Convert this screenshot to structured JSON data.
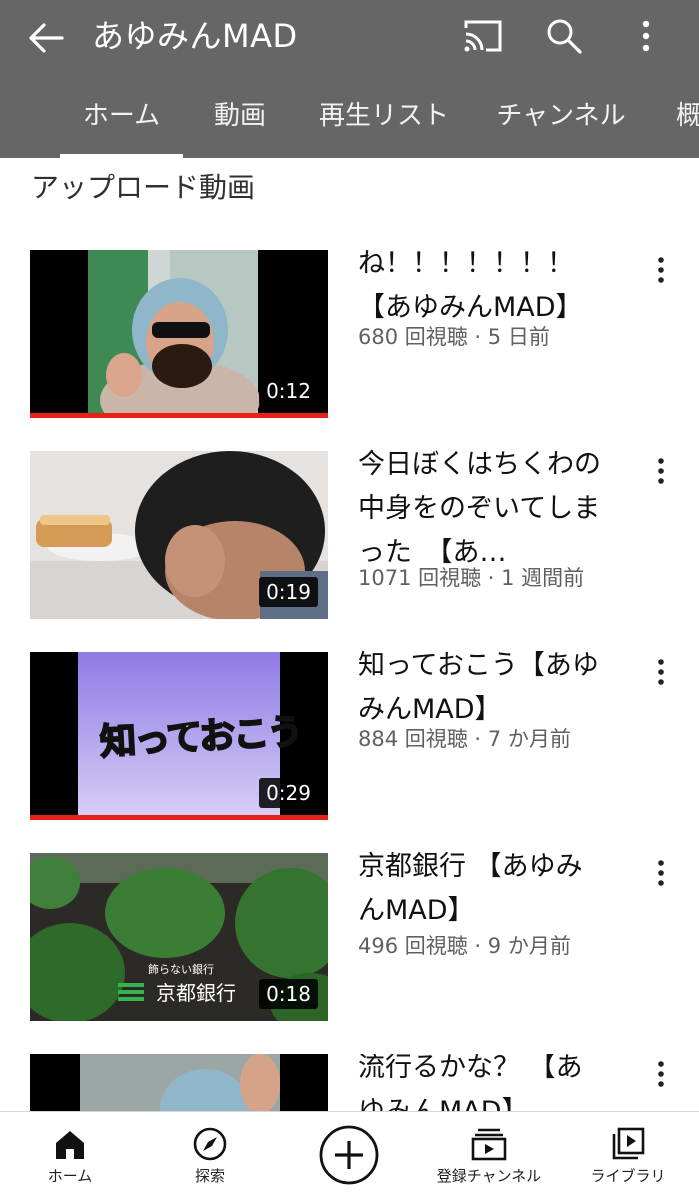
{
  "header": {
    "title": "あゆみんMAD",
    "tabs": [
      {
        "label": "ホーム"
      },
      {
        "label": "動画"
      },
      {
        "label": "再生リスト"
      },
      {
        "label": "チャンネル"
      },
      {
        "label": "概"
      }
    ]
  },
  "section_title": "アップロード動画",
  "videos": [
    {
      "title": "ね！！！！！！！【あゆみんMAD】",
      "meta": "680 回視聴 · 5 日前",
      "duration": "0:12",
      "watch_progress": 1.0
    },
    {
      "title": "今日ぼくはちくわの中身をのぞいてしまった　【あ…",
      "meta": "1071 回視聴 · 1 週間前",
      "duration": "0:19"
    },
    {
      "title": "知っておこう【あゆみんMAD】",
      "meta": "884 回視聴 · 7 か月前",
      "duration": "0:29",
      "watch_progress": 1.0,
      "thumb_text": "知っておこう"
    },
    {
      "title": "京都銀行 【あゆみんMAD】",
      "meta": "496 回視聴 · 9 か月前",
      "duration": "0:18",
      "thumb_caption": "飾らない銀行",
      "thumb_logo_text": "京都銀行"
    },
    {
      "title": "流行るかな？ 【あゆみんMAD】"
    }
  ],
  "bottom_nav": [
    {
      "label": "ホーム",
      "icon": "home-icon"
    },
    {
      "label": "探索",
      "icon": "explore-icon"
    },
    {
      "label": "",
      "icon": "create-icon"
    },
    {
      "label": "登録チャンネル",
      "icon": "subscriptions-icon"
    },
    {
      "label": "ライブラリ",
      "icon": "library-icon"
    }
  ],
  "colors": {
    "header_bg": "#666666",
    "progress": "#e62117",
    "meta_text": "#606060"
  }
}
